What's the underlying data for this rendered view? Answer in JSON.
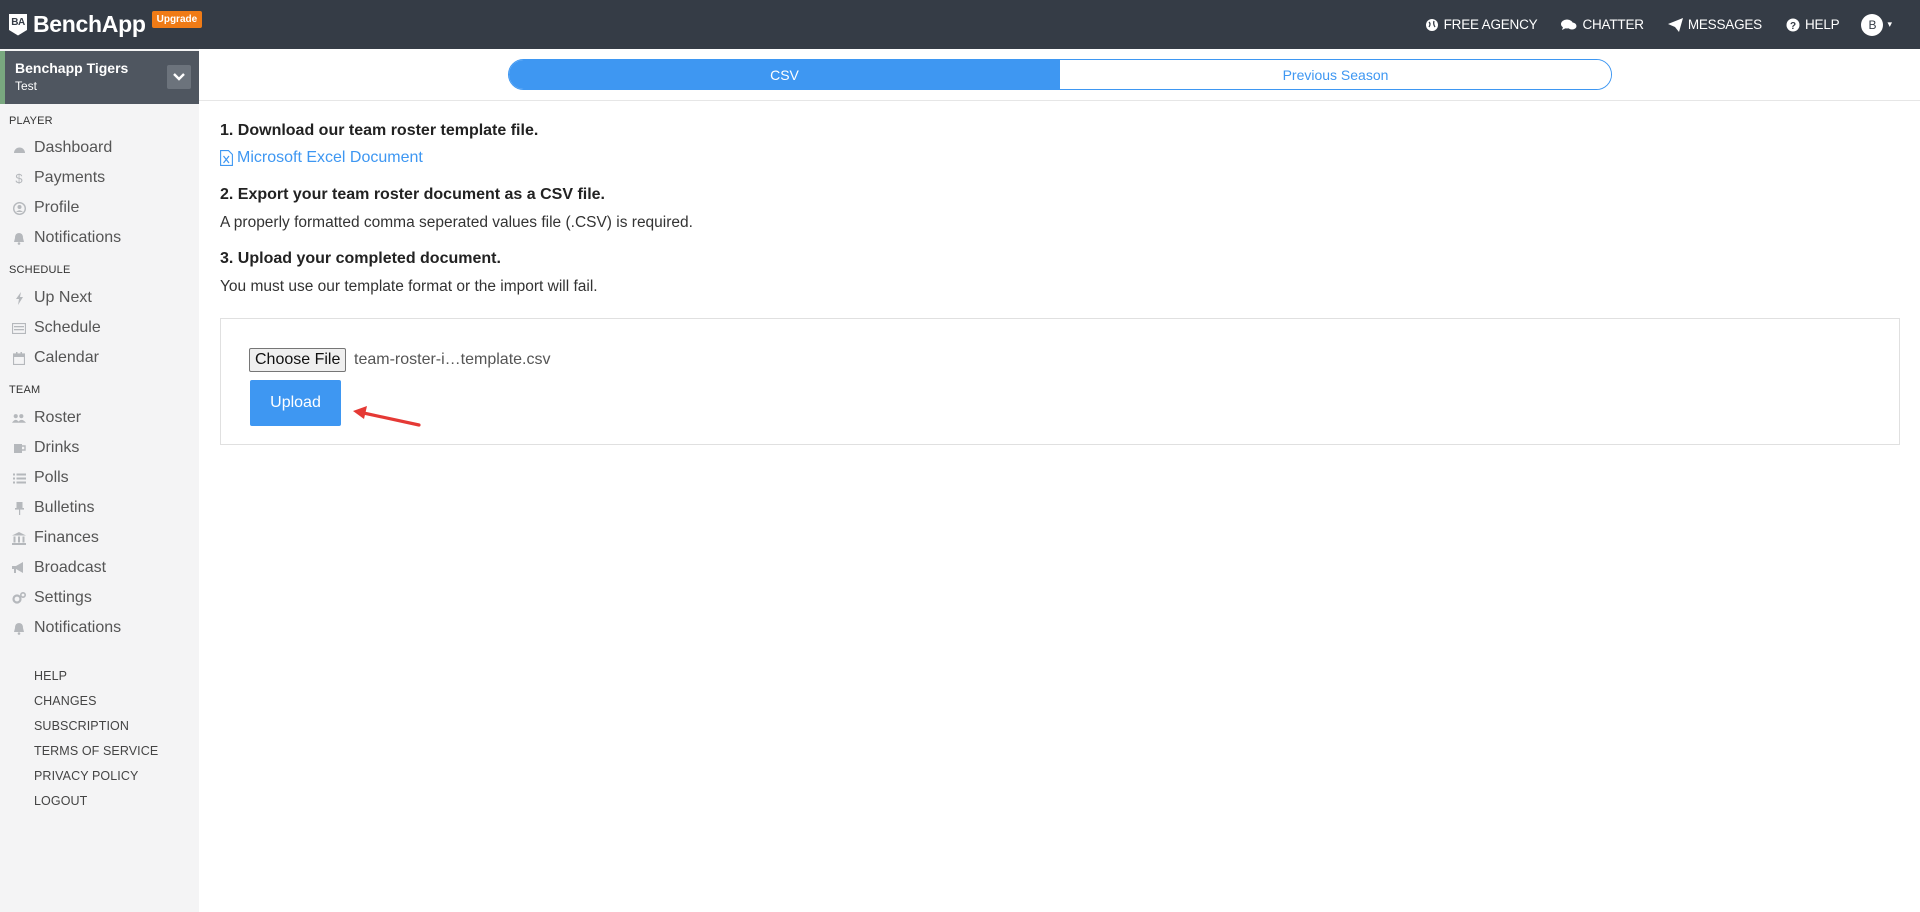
{
  "brand": {
    "badge": "BA",
    "name": "BenchApp",
    "upgrade": "Upgrade"
  },
  "topnav": {
    "items": [
      {
        "label": "FREE AGENCY",
        "icon": "globe-icon"
      },
      {
        "label": "CHATTER",
        "icon": "comments-icon"
      },
      {
        "label": "MESSAGES",
        "icon": "paper-plane-icon"
      },
      {
        "label": "HELP",
        "icon": "question-circle-icon"
      }
    ],
    "avatar": "B"
  },
  "team": {
    "name": "Benchapp Tigers",
    "sub": "Test"
  },
  "sidebar": {
    "player_heading": "PLAYER",
    "player_items": [
      {
        "label": "Dashboard",
        "icon": "dashboard-icon"
      },
      {
        "label": "Payments",
        "icon": "dollar-icon"
      },
      {
        "label": "Profile",
        "icon": "user-circle-icon"
      },
      {
        "label": "Notifications",
        "icon": "bell-icon"
      }
    ],
    "schedule_heading": "SCHEDULE",
    "schedule_items": [
      {
        "label": "Up Next",
        "icon": "bolt-icon"
      },
      {
        "label": "Schedule",
        "icon": "list-alt-icon"
      },
      {
        "label": "Calendar",
        "icon": "calendar-icon"
      }
    ],
    "team_heading": "TEAM",
    "team_items": [
      {
        "label": "Roster",
        "icon": "users-icon"
      },
      {
        "label": "Drinks",
        "icon": "beer-icon"
      },
      {
        "label": "Polls",
        "icon": "list-icon"
      },
      {
        "label": "Bulletins",
        "icon": "thumbtack-icon"
      },
      {
        "label": "Finances",
        "icon": "bank-icon"
      },
      {
        "label": "Broadcast",
        "icon": "bullhorn-icon"
      },
      {
        "label": "Settings",
        "icon": "cogs-icon"
      },
      {
        "label": "Notifications",
        "icon": "bell-icon"
      }
    ],
    "footer_links": [
      "HELP",
      "CHANGES",
      "SUBSCRIPTION",
      "TERMS OF SERVICE",
      "PRIVACY POLICY",
      "LOGOUT"
    ]
  },
  "tabs": {
    "active": "CSV",
    "inactive": "Previous Season"
  },
  "steps": {
    "step1_title": "1. Download our team roster template file.",
    "step1_link": "Microsoft Excel Document",
    "step2_title": "2. Export your team roster document as a CSV file.",
    "step2_text": "A properly formatted comma seperated values file (.CSV) is required.",
    "step3_title": "3. Upload your completed document.",
    "step3_text": "You must use our template format or the import will fail."
  },
  "upload": {
    "choose_label": "Choose File",
    "file_name": "team-roster-i…template.csv",
    "upload_label": "Upload"
  },
  "colors": {
    "accent": "#3e97f2",
    "topbar": "#353c46",
    "upgrade": "#f07b16",
    "annotation_arrow": "#e53935"
  }
}
